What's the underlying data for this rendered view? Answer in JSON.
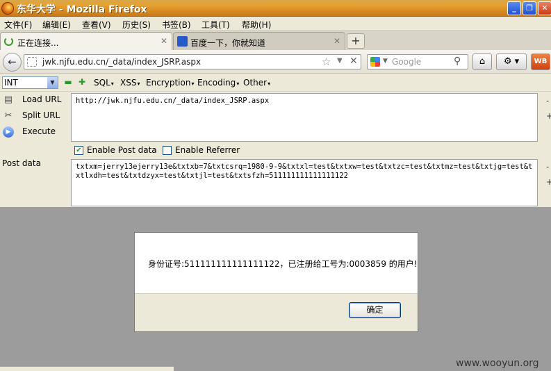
{
  "window": {
    "title": "东华大学 - Mozilla Firefox"
  },
  "menu": [
    "文件(F)",
    "编辑(E)",
    "查看(V)",
    "历史(S)",
    "书签(B)",
    "工具(T)",
    "帮助(H)"
  ],
  "tabs": [
    {
      "label": "正在连接..."
    },
    {
      "label": "百度一下，你就知道"
    }
  ],
  "navbar": {
    "url": "jwk.njfu.edu.cn/_data/index_JSRP.aspx",
    "search_placeholder": "Google",
    "wb_label": "WB"
  },
  "hackbar": {
    "select_value": "INT",
    "menus": [
      "SQL",
      "XSS",
      "Encryption",
      "Encoding",
      "Other"
    ],
    "actions": [
      "Load URL",
      "Split URL",
      "Execute"
    ],
    "url_text": "http://jwk.njfu.edu.cn/_data/index_JSRP.aspx",
    "enable_post": "Enable Post data",
    "enable_referrer": "Enable Referrer",
    "post_label": "Post data",
    "post_text": "txtxm=jerry13ejerry13e&txtxb=7&txtcsrq=1980-9-9&txtxl=test&txtxw=test&txtzc=test&txtmz=test&txtjg=test&txtlxdh=test&txtdzyx=test&txtjl=test&txtsfzh=511111111111111122"
  },
  "dialog": {
    "message": "身份证号:511111111111111122，已注册给工号为:0003859  的用户!",
    "ok_label": "确定"
  },
  "watermark": "www.wooyun.org"
}
